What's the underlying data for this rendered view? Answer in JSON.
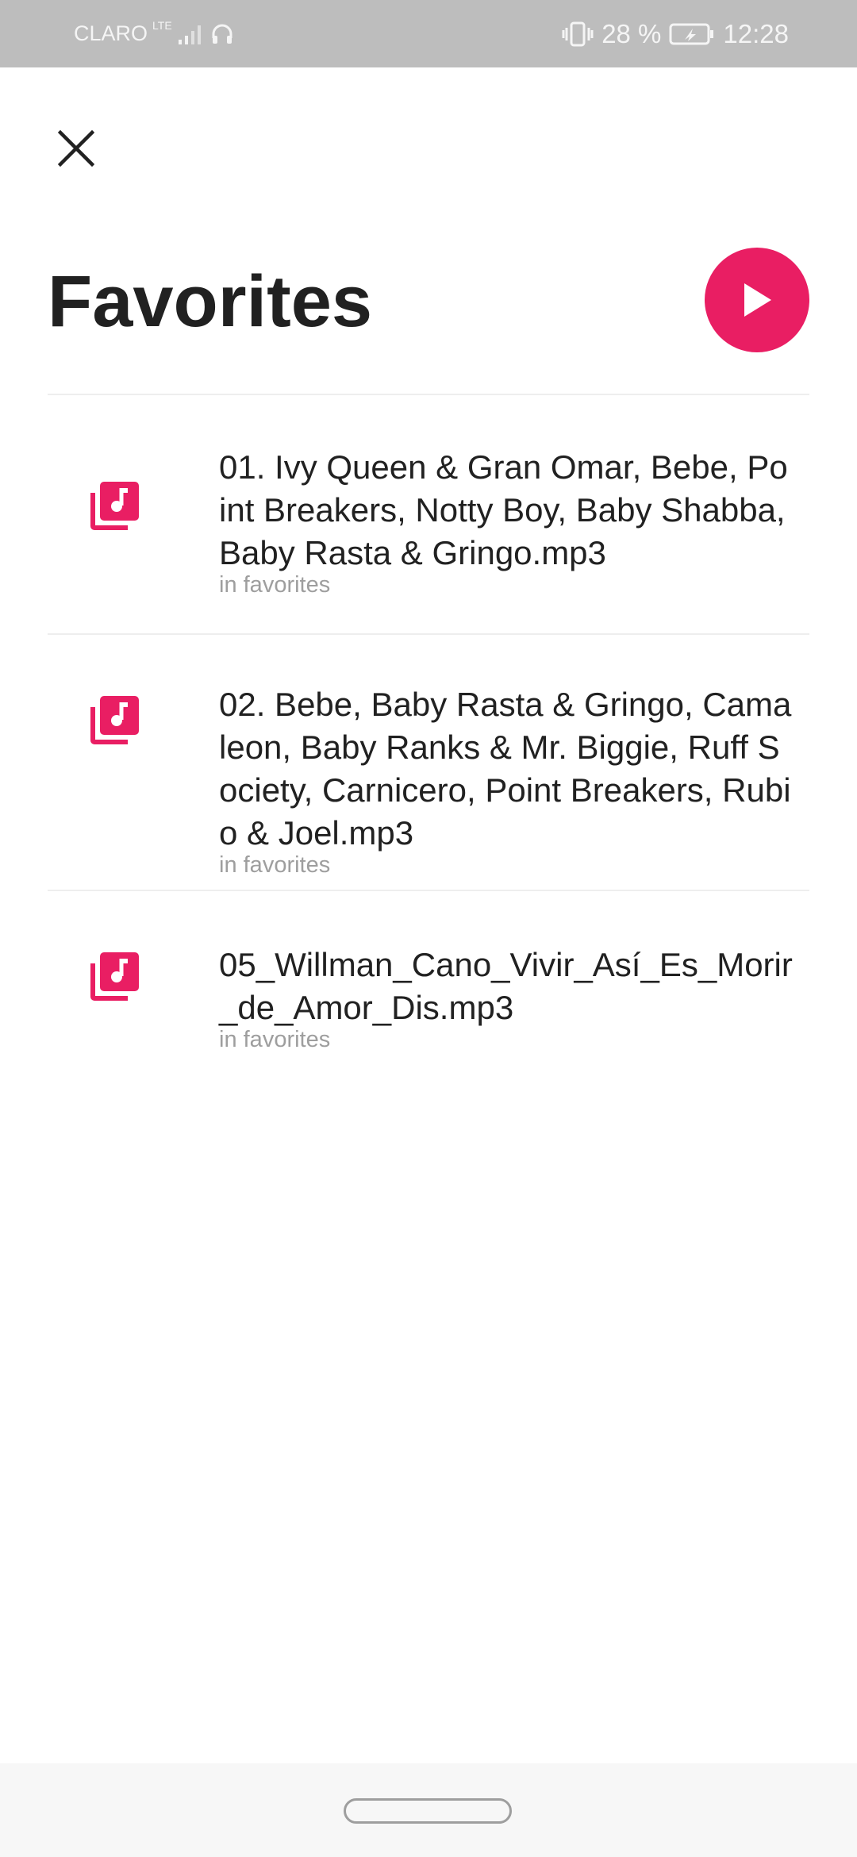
{
  "status_bar": {
    "carrier": "CLARO",
    "network": "LTE",
    "battery_percent": "28 %",
    "time": "12:28",
    "icons": [
      "signal-icon",
      "headphones-icon",
      "vibrate-icon",
      "battery-icon"
    ]
  },
  "header": {
    "close_icon": "close-icon",
    "title": "Favorites",
    "play_icon": "play-icon"
  },
  "accent_color": "#e91e63",
  "tracks": [
    {
      "title": "01. Ivy Queen & Gran Omar, Bebe, Point Breakers, Notty Boy, Baby Shabba, Baby Rasta & Gringo.mp3",
      "subtitle": "in favorites",
      "icon": "music-library-icon"
    },
    {
      "title": "02. Bebe, Baby Rasta & Gringo, Camaleon, Baby Ranks & Mr. Biggie, Ruff Society, Carnicero, Point Breakers, Rubio & Joel.mp3",
      "subtitle": "in favorites",
      "icon": "music-library-icon"
    },
    {
      "title": "05_Willman_Cano_Vivir_Así_Es_Morir_de_Amor_Dis.mp3",
      "subtitle": "in favorites",
      "icon": "music-library-icon"
    }
  ]
}
